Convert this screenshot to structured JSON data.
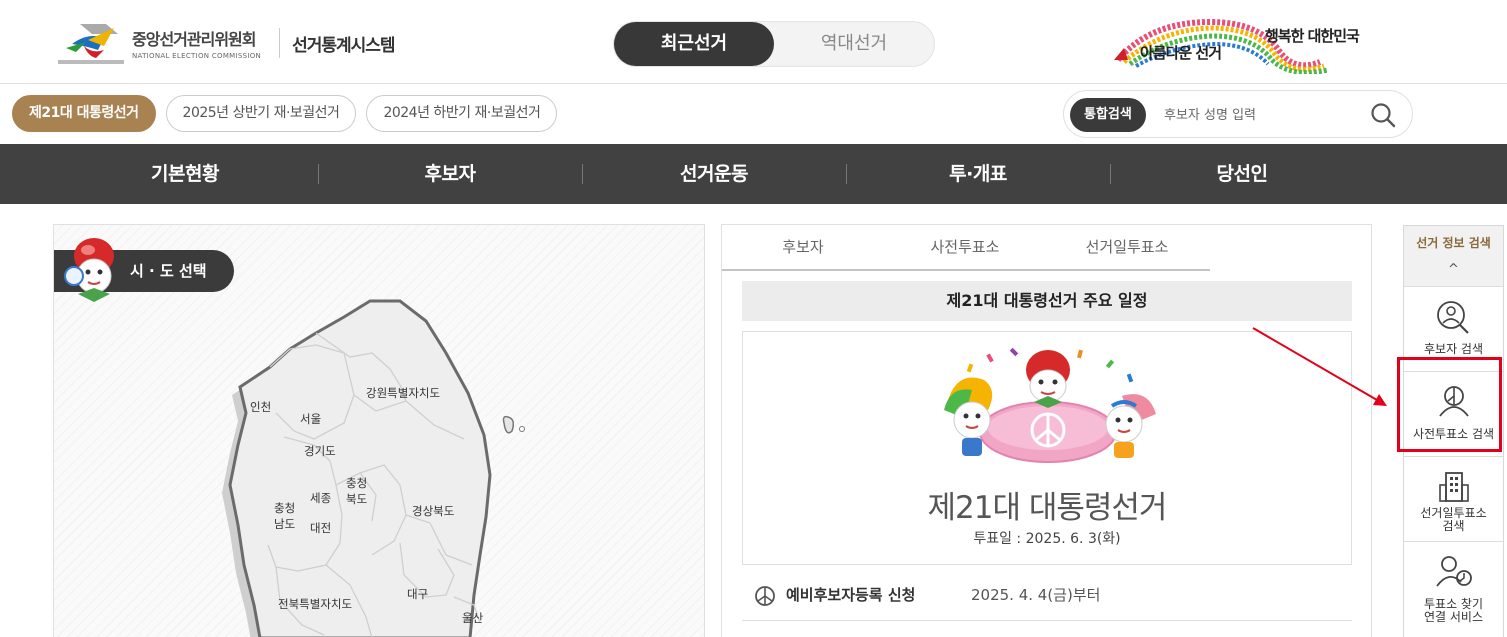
{
  "header": {
    "org_name": "중앙선거관리위원회",
    "org_sub": "NATIONAL ELECTION COMMISSION",
    "system_name": "선거통계시스템",
    "toggle": {
      "active": "최근선거",
      "inactive": "역대선거"
    },
    "slogan_left": "아름다운 선거",
    "slogan_right": "행복한 대한민국"
  },
  "election_tabs": [
    {
      "label": "제21대 대통령선거",
      "active": true
    },
    {
      "label": "2025년 상반기 재·보궐선거",
      "active": false
    },
    {
      "label": "2024년 하반기 재·보궐선거",
      "active": false
    }
  ],
  "search": {
    "label": "통합검색",
    "placeholder": "후보자 성명 입력"
  },
  "gnb": [
    "기본현황",
    "후보자",
    "선거운동",
    "투·개표",
    "당선인"
  ],
  "map": {
    "title": "시 · 도 선택",
    "regions": {
      "incheon": "인천",
      "seoul": "서울",
      "gyeonggi": "경기도",
      "gangwon": "강원특별자치도",
      "chungbuk_1": "충청",
      "chungbuk_2": "북도",
      "chungnam_1": "충청",
      "chungnam_2": "남도",
      "sejong": "세종",
      "daejeon": "대전",
      "gyeongbuk": "경상북도",
      "daegu": "대구",
      "jeonbuk": "전북특별자치도",
      "ulsan": "울산"
    }
  },
  "schedule": {
    "tabs": [
      "후보자",
      "사전투표소",
      "선거일투표소"
    ],
    "heading": "제21대 대통령선거 주요 일정",
    "election_title": "제21대 대통령선거",
    "vote_date": "투표일 : 2025. 6. 3(화)",
    "rows": [
      {
        "label": "예비후보자등록 신청",
        "date": "2025. 4. 4(금)부터"
      }
    ]
  },
  "quick": {
    "title": "선거 정보 검색",
    "up_arrow": "^",
    "items": [
      {
        "line1": "후보자 검색",
        "line2": "",
        "icon": "person-search-icon"
      },
      {
        "line1": "사전투표소 검색",
        "line2": "",
        "icon": "ballot-person-icon"
      },
      {
        "line1": "선거일투표소",
        "line2": "검색",
        "icon": "building-icon"
      },
      {
        "line1": "투표소 찾기",
        "line2": "연결 서비스",
        "icon": "person-clock-icon"
      }
    ]
  },
  "colors": {
    "brand_gold": "#a88251",
    "gnb_bg": "#414141",
    "toggle_active": "#383838",
    "highlight_red": "#e3001b"
  }
}
